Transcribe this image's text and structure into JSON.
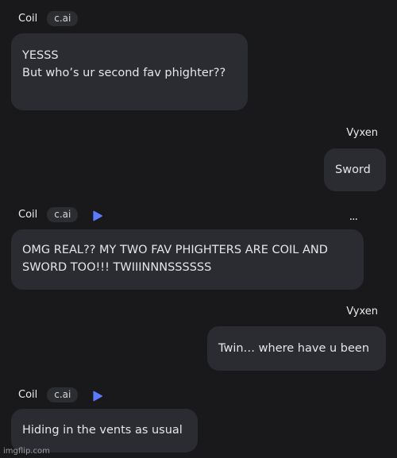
{
  "messages": [
    {
      "sender": "Coil",
      "badge": "c.ai",
      "lines": [
        "YESSS",
        "",
        "But who’s ur second fav phighter??"
      ]
    },
    {
      "sender": "Vyxen",
      "text": "Sword"
    },
    {
      "sender": "Coil",
      "badge": "c.ai",
      "lines": [
        "OMG REAL?? MY TWO FAV PHIGHTERS ARE COIL AND",
        "SWORD TOO!!! TWIIINNNSSSSSS"
      ],
      "more": "..."
    },
    {
      "sender": "Vyxen",
      "text": "Twin… where have u been"
    },
    {
      "sender": "Coil",
      "badge": "c.ai",
      "text": "Hiding in the vents as usual"
    }
  ],
  "icons": {
    "play": "play-icon",
    "more": "more-options-icon"
  },
  "colors": {
    "background": "#19191c",
    "bubble": "#2b2c31",
    "play_accent": "#5b7bff"
  },
  "watermark": "imgflip.com"
}
